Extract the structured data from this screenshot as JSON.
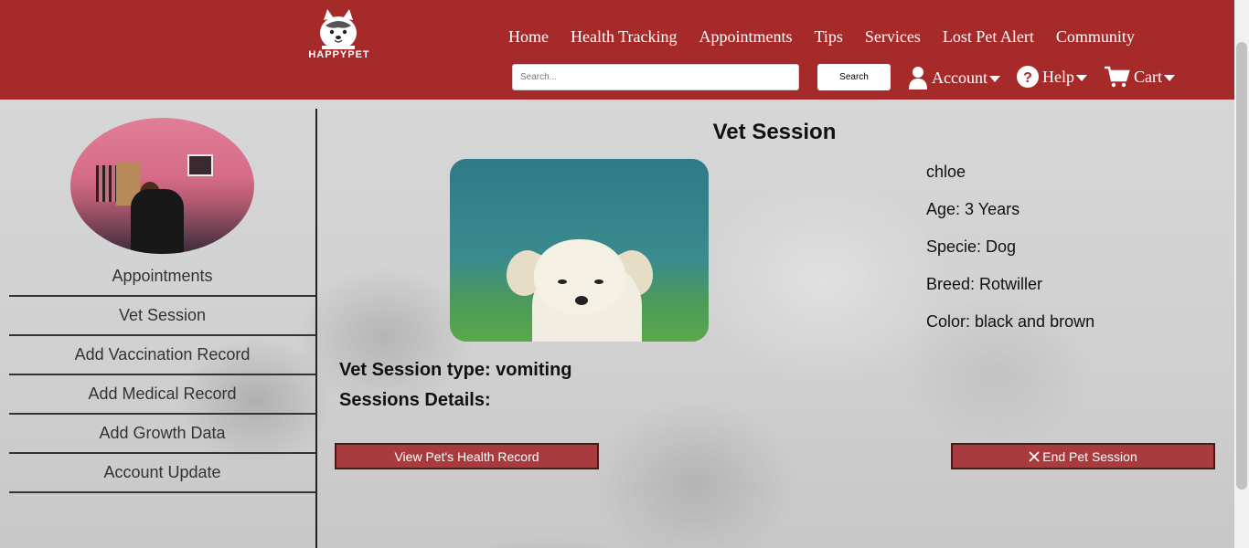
{
  "header": {
    "logo_text": "HAPPYPET",
    "nav": [
      "Home",
      "Health Tracking",
      "Appointments",
      "Tips",
      "Services",
      "Lost Pet Alert",
      "Community"
    ],
    "search_placeholder": "Search...",
    "search_button": "Search",
    "account_label": "Account",
    "help_label": "Help",
    "cart_label": "Cart",
    "brand_color": "#a72a2a"
  },
  "sidebar": {
    "items": [
      "Appointments",
      "Vet Session",
      "Add Vaccination Record",
      "Add Medical Record",
      "Add Growth Data",
      "Account Update"
    ]
  },
  "main": {
    "title": "Vet Session",
    "pet": {
      "name": "chloe",
      "age": "Age: 3 Years",
      "specie": "Specie: Dog",
      "breed": "Breed: Rotwiller",
      "color": "Color: black and brown"
    },
    "session_type": "Vet Session type: vomiting",
    "session_details": "Sessions Details:",
    "view_record_button": "View Pet's Health Record",
    "end_session_button": "End Pet Session"
  }
}
